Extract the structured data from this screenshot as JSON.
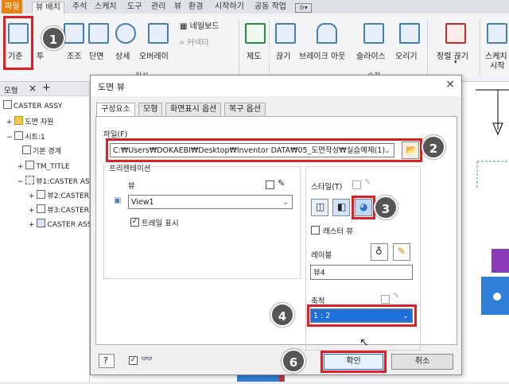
{
  "ribbon": {
    "tabs": [
      "파일",
      "뷰 배치",
      "주석",
      "스케치",
      "도구",
      "관리",
      "뷰",
      "환경",
      "시작하기",
      "공동 작업"
    ],
    "buttons": {
      "base": "기준",
      "projected": "투",
      "aux": "조조",
      "section": "단면",
      "detail": "상세",
      "overlay": "오버레이",
      "nailboard": "네일보드",
      "connector": "커넥터",
      "produce": "제도",
      "break": "끊기",
      "breakout": "브레이크 아웃",
      "slice": "슬라이스",
      "crop": "오리기",
      "align": "정렬 끊기",
      "sketch": "스케치",
      "start": "시작"
    },
    "groups": {
      "create": "작성",
      "modify": "수정"
    }
  },
  "browser": {
    "tab": "모형",
    "items": [
      "CASTER ASSY",
      "도면 자원",
      "시트:1",
      "기본 경계",
      "TM_TITLE",
      "뷰1:CASTER AS",
      "뷰2:CASTER",
      "뷰3:CASTER",
      "CASTER ASS"
    ]
  },
  "dialog": {
    "title": "도면 뷰",
    "close": "×",
    "tabs": [
      "구성요소",
      "모형",
      "화면표시 옵션",
      "복구 옵션"
    ],
    "file_label": "파일(F)",
    "file_path": "C:₩Users₩DOKAEBI₩Desktop₩Inventor DATA₩05_도면작성₩실습예제(1)",
    "presentation_label": "프리젠테이션",
    "view_label": "뷰",
    "view_value": "View1",
    "trail_label": "트레일 표시",
    "style_label": "스타일(T)",
    "raster_label": "래스터 뷰",
    "label_label": "레이블",
    "label_value": "뷰4",
    "scale_label": "축척",
    "scale_value": "1 : 2",
    "ok": "확인",
    "cancel": "취소"
  },
  "badges": [
    "1",
    "2",
    "3",
    "4",
    "6"
  ],
  "colors": {
    "highlight": "#e01e24",
    "badge": "#555555",
    "accent": "#4a7fb5"
  }
}
